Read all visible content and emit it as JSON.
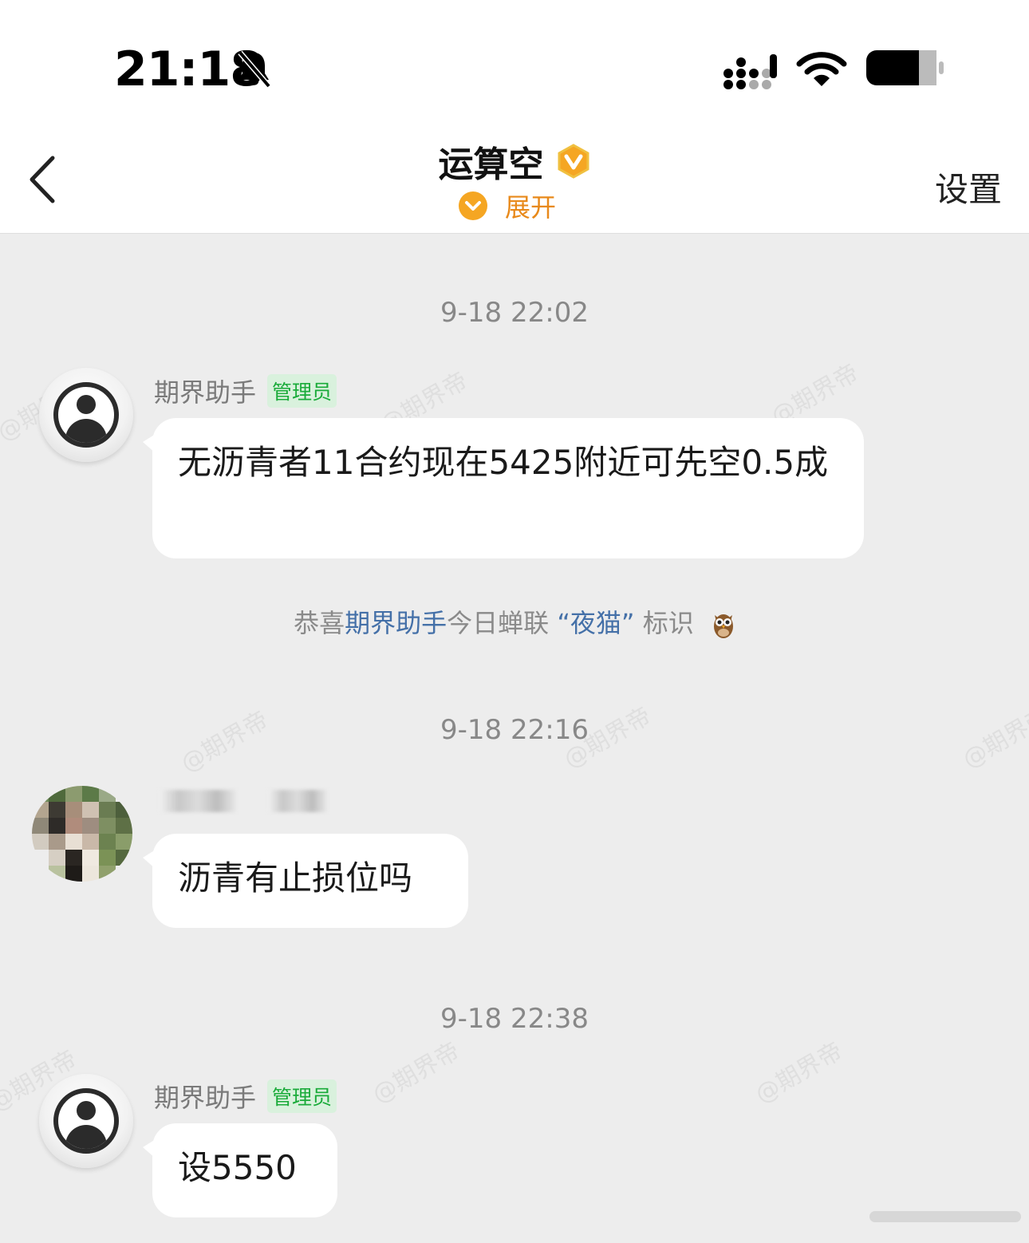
{
  "status_bar": {
    "time": "21:18",
    "icons": [
      "bell-slash-icon",
      "signal-icon",
      "wifi-icon",
      "battery-icon"
    ]
  },
  "header": {
    "title": "运算空",
    "expand_label": "展开",
    "settings_label": "设置",
    "icons": [
      "back-chevron-icon",
      "verified-v-badge-icon",
      "chevron-down-icon"
    ]
  },
  "messages": [
    {
      "timestamp": "9-18 22:02",
      "sender": "期界助手",
      "role": "管理员",
      "text": "无沥青者11合约现在5425附近可先空0.5成"
    },
    {
      "timestamp": "9-18 22:16",
      "sender": "",
      "role": "",
      "text": "沥青有止损位吗"
    },
    {
      "timestamp": "9-18 22:38",
      "sender": "期界助手",
      "role": "管理员",
      "text": "设5550"
    }
  ],
  "system_message": {
    "prefix": "恭喜",
    "user": "期界助手",
    "middle": "今日蝉联 ",
    "badge_name": "“夜猫”",
    "suffix": " 标识",
    "icon": "owl-icon"
  },
  "watermark": "@期界帝",
  "colors": {
    "accent_orange": "#f5a623",
    "admin_green": "#1aab3a",
    "link_blue": "#4470a8",
    "background": "#ededed"
  }
}
